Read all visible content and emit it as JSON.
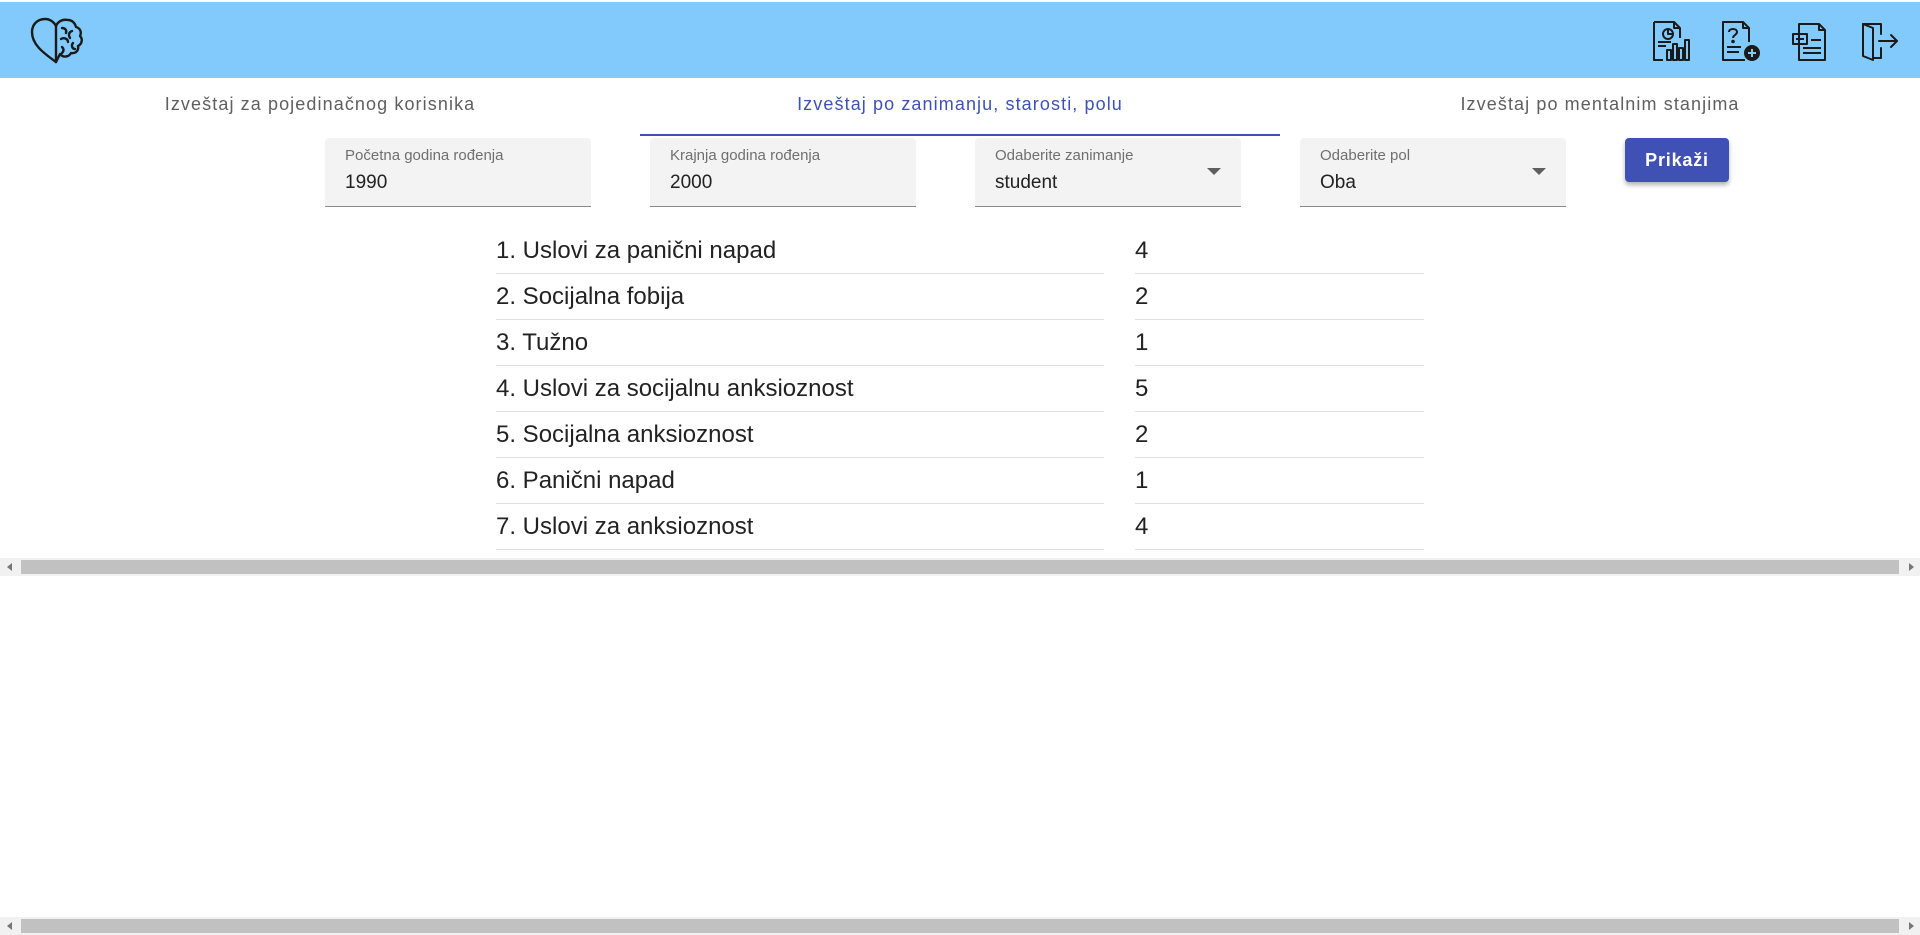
{
  "appbar": {
    "logo_icon": "brain-heart-icon",
    "actions": [
      {
        "icon": "report-chart-icon"
      },
      {
        "icon": "question-doc-add-icon"
      },
      {
        "icon": "document-list-icon"
      },
      {
        "icon": "logout-icon"
      }
    ],
    "colors": {
      "bar": "#82cafc",
      "accent": "#3f51b5"
    }
  },
  "tabs": [
    {
      "label": "Izveštaj za pojedinačnog korisnika",
      "active": false
    },
    {
      "label": "Izveštaj po zanimanju, starosti, polu",
      "active": true
    },
    {
      "label": "Izveštaj po mentalnim stanjima",
      "active": false
    }
  ],
  "filters": {
    "start_year": {
      "label": "Početna godina rođenja",
      "value": "1990"
    },
    "end_year": {
      "label": "Krajnja godina rođenja",
      "value": "2000"
    },
    "occupation": {
      "label": "Odaberite zanimanje",
      "value": "student"
    },
    "gender": {
      "label": "Odaberite pol",
      "value": "Oba"
    },
    "show_label": "Prikaži"
  },
  "results": [
    {
      "name": "1. Uslovi za panični napad",
      "count": "4"
    },
    {
      "name": "2. Socijalna fobija",
      "count": "2"
    },
    {
      "name": "3. Tužno",
      "count": "1"
    },
    {
      "name": "4. Uslovi za socijalnu anksioznost",
      "count": "5"
    },
    {
      "name": "5. Socijalna anksioznost",
      "count": "2"
    },
    {
      "name": "6. Panični napad",
      "count": "1"
    },
    {
      "name": "7. Uslovi za anksioznost",
      "count": "4"
    }
  ]
}
